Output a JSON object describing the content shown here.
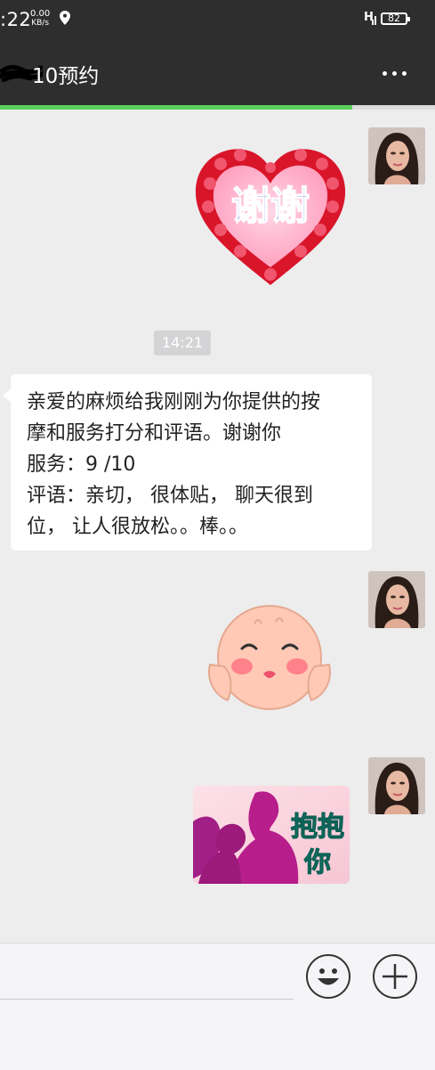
{
  "status": {
    "time": ":22",
    "speed_value": "0.00",
    "speed_unit": "KB/s",
    "network": "H",
    "battery": "82"
  },
  "header": {
    "title": "10预约",
    "progress": 0.81
  },
  "messages": {
    "sticker1_text": "谢谢",
    "timestamp": "14:21",
    "bubble_lines": [
      "亲爱的麻烦给我刚刚为你提供的按",
      "摩和服务打分和评语。谢谢你",
      "服务：9 /10",
      "评语：亲切，  很体贴，  聊天很到",
      "位，  让人很放松。。棒。。"
    ],
    "sticker3_text_1": "抱抱",
    "sticker3_text_2": "你"
  },
  "icons": {
    "more": "more-icon",
    "emoji": "emoji-icon",
    "plus": "plus-icon"
  },
  "colors": {
    "header_bg": "#2e2e2e",
    "progress": "#5ad05a",
    "chat_bg": "#ededee"
  }
}
